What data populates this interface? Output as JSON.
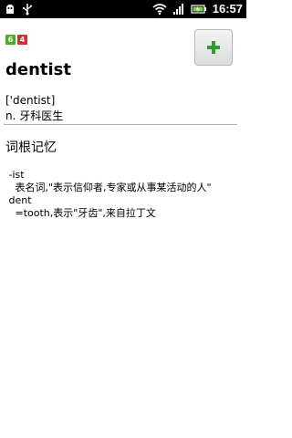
{
  "statusbar": {
    "time": "16:57",
    "left_icons": [
      "usb-debug-icon",
      "usb-icon"
    ],
    "right_icons": [
      "wifi-icon",
      "signal-icon",
      "battery-icon"
    ]
  },
  "badges": [
    {
      "label": "6",
      "color": "#4caf1e"
    },
    {
      "label": "4",
      "color": "#d32f2f"
    }
  ],
  "add_button": {
    "icon": "plus-icon",
    "color": "#2e9e2e"
  },
  "entry": {
    "word": "dentist",
    "phonetic": "['dentist]",
    "meaning": "n. 牙科医生"
  },
  "etymology": {
    "title": "词根记忆",
    "lines": [
      " -ist",
      "   表名词,\"表示信仰者,专家或从事某活动的人\"",
      " dent",
      "   =tooth,表示\"牙齿\",来自拉丁文"
    ]
  }
}
